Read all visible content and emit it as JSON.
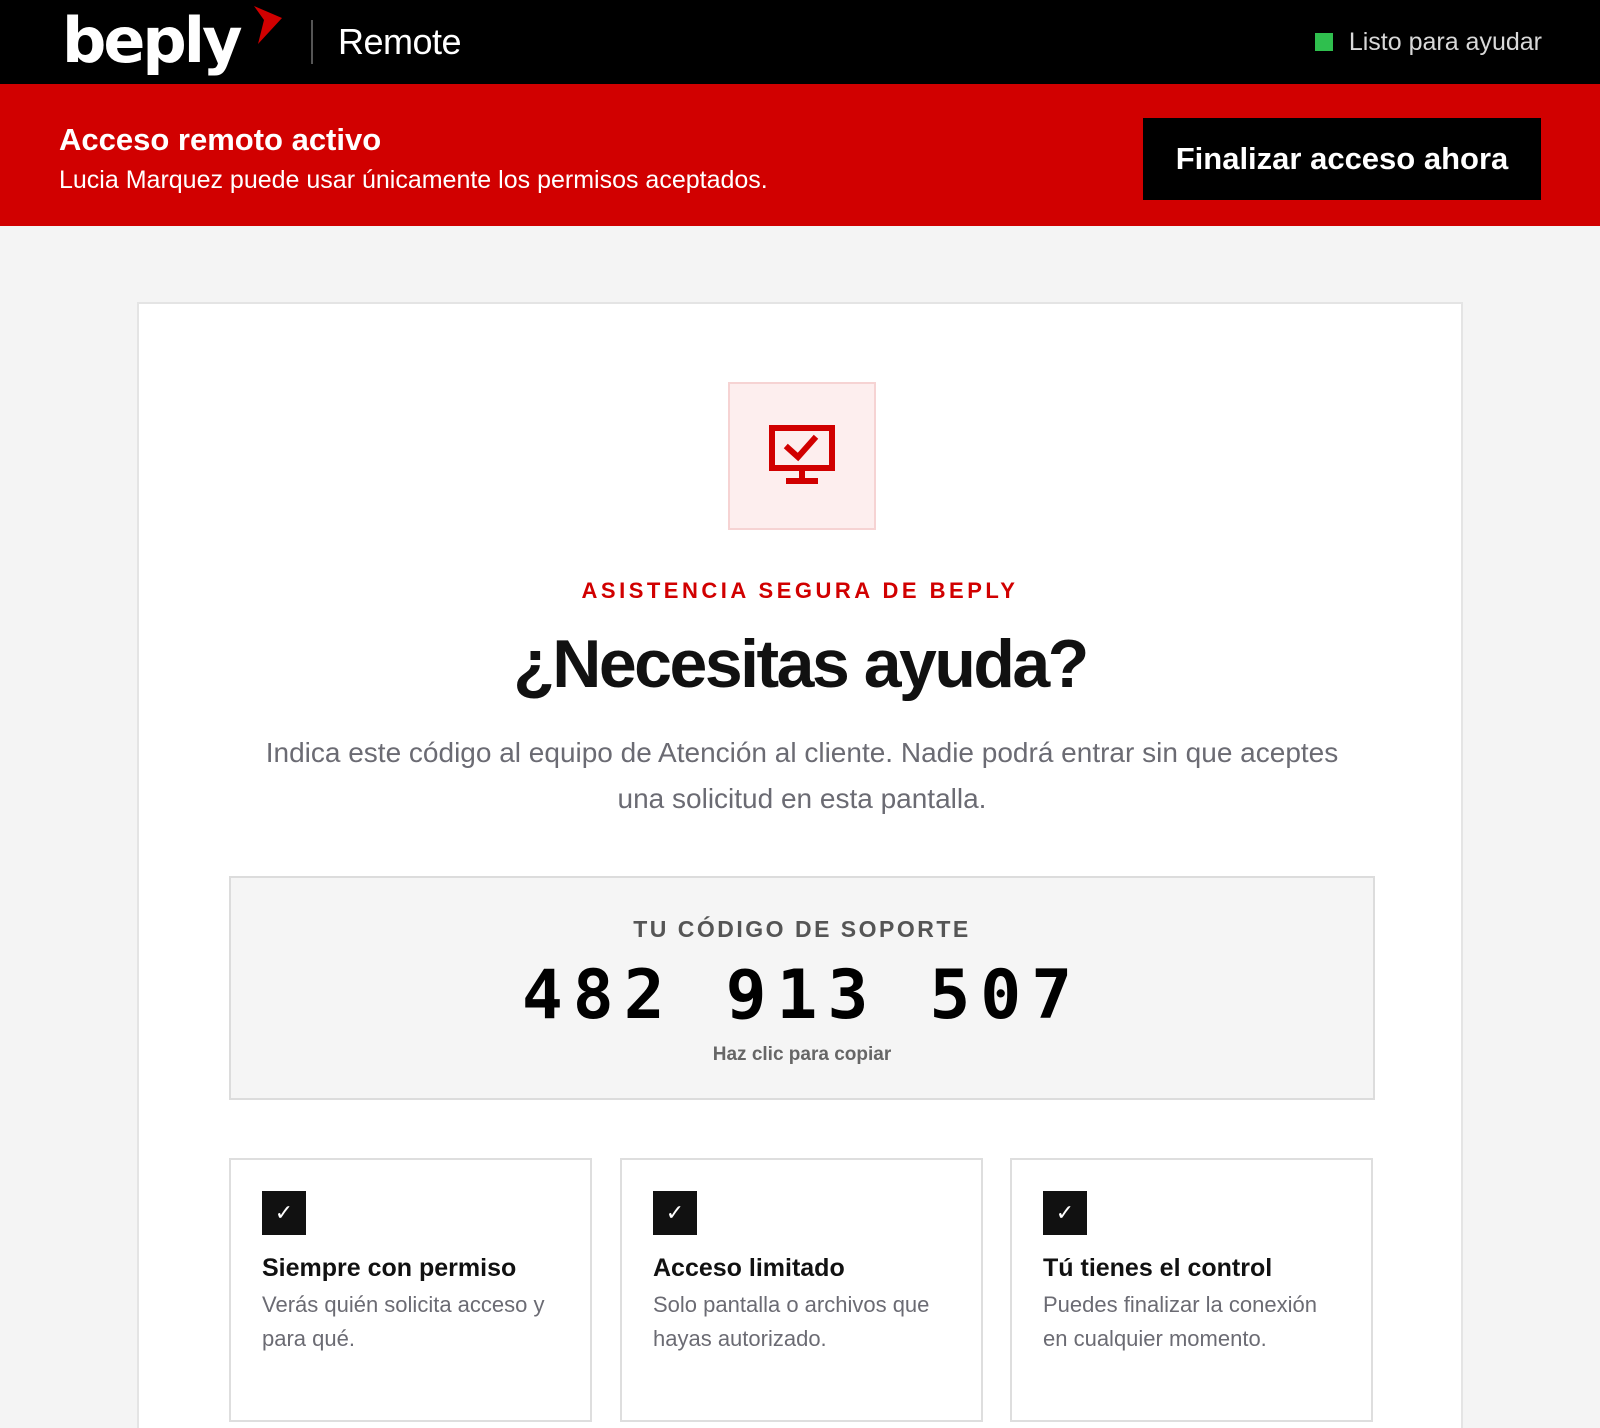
{
  "header": {
    "logo_text": "beply",
    "product_name": "Remote",
    "status_text": "Listo para ayudar",
    "status_color": "#2fbf4e"
  },
  "banner": {
    "title": "Acceso remoto activo",
    "subtitle": "Lucia Marquez puede usar únicamente los permisos aceptados.",
    "end_button_label": "Finalizar acceso ahora",
    "color": "#d10000"
  },
  "main": {
    "icon": "monitor-check-icon",
    "eyebrow": "ASISTENCIA SEGURA DE BEPLY",
    "headline": "¿Necesitas ayuda?",
    "intro": "Indica este código al equipo de Atención al cliente. Nadie podrá entrar sin que aceptes una solicitud en esta pantalla.",
    "code": {
      "label": "TU CÓDIGO DE SOPORTE",
      "value": "482 913 507",
      "hint": "Haz clic para copiar"
    },
    "features": [
      {
        "icon": "check-icon",
        "title": "Siempre con permiso",
        "description": "Verás quién solicita acceso y para qué."
      },
      {
        "icon": "check-icon",
        "title": "Acceso limitado",
        "description": "Solo pantalla o archivos que hayas autorizado."
      },
      {
        "icon": "check-icon",
        "title": "Tú tienes el control",
        "description": "Puedes finalizar la conexión en cualquier momento."
      }
    ]
  }
}
